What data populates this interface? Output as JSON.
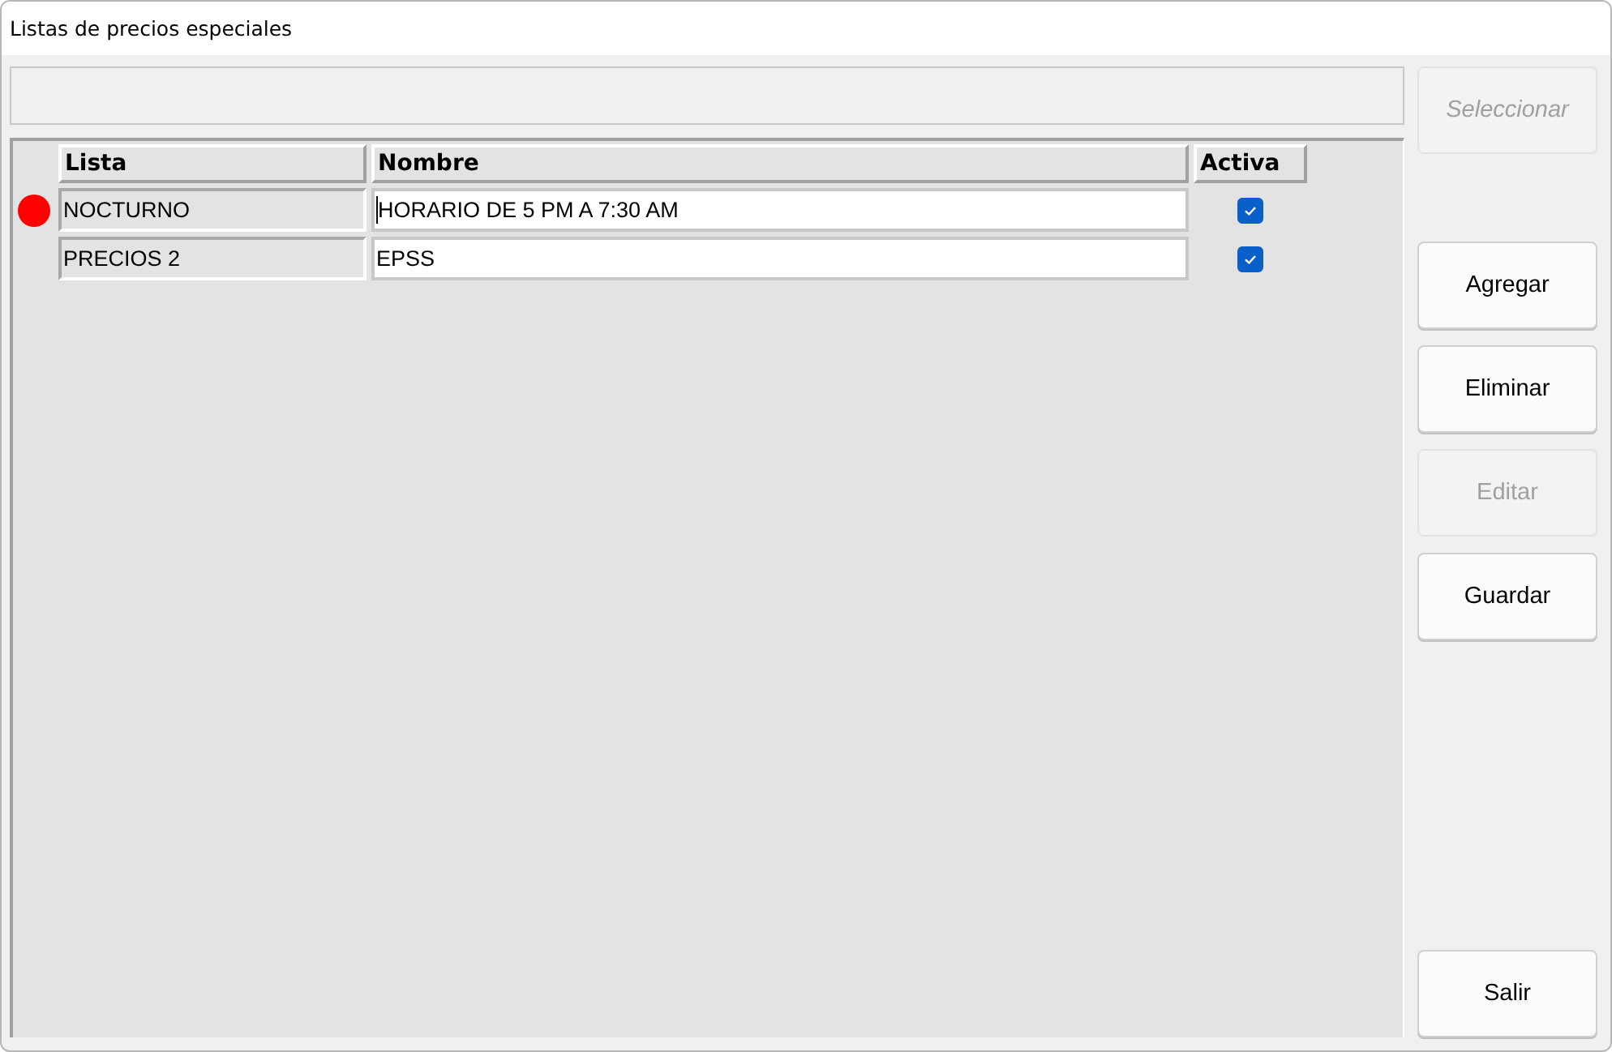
{
  "window": {
    "title": "Listas de precios especiales"
  },
  "table": {
    "columns": [
      "Lista",
      "Nombre",
      "Activa"
    ],
    "rows": [
      {
        "lista": "NOCTURNO",
        "nombre": "HORARIO DE 5 PM A 7:30 AM",
        "activa": true,
        "selected": true
      },
      {
        "lista": "PRECIOS 2",
        "nombre": "EPSS",
        "activa": true,
        "selected": false
      }
    ]
  },
  "buttons": [
    {
      "label": "Seleccionar",
      "disabled": true,
      "italic": true
    },
    {
      "label": "Agregar",
      "disabled": false,
      "italic": false
    },
    {
      "label": "Eliminar",
      "disabled": false,
      "italic": false
    },
    {
      "label": "Editar",
      "disabled": true,
      "italic": false
    },
    {
      "label": "Guardar",
      "disabled": false,
      "italic": false
    },
    {
      "label": "Salir",
      "disabled": false,
      "italic": false
    }
  ]
}
